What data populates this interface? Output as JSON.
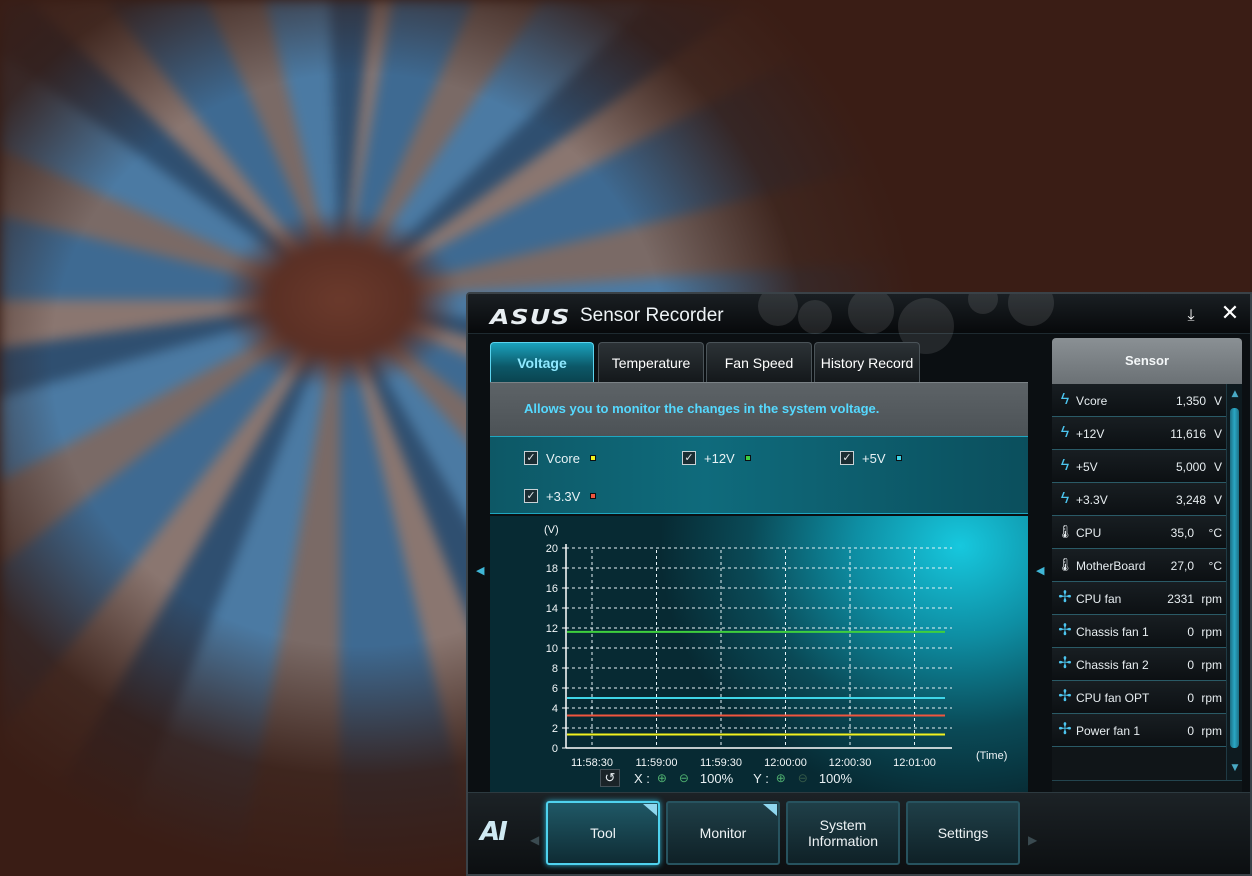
{
  "window": {
    "logo": "ASUS",
    "title": "Sensor Recorder",
    "minimize_glyph": "⤓",
    "close_glyph": "✕"
  },
  "tabs": [
    {
      "label": "Voltage",
      "active": true
    },
    {
      "label": "Temperature",
      "active": false
    },
    {
      "label": "Fan Speed",
      "active": false
    },
    {
      "label": "History Record",
      "active": false
    }
  ],
  "description": "Allows you to monitor the changes in the system voltage.",
  "legend": [
    {
      "label": "Vcore",
      "checked": true,
      "color": "#f2f21e"
    },
    {
      "label": "+12V",
      "checked": true,
      "color": "#3ecf3e"
    },
    {
      "label": "+5V",
      "checked": true,
      "color": "#3fd6e8"
    },
    {
      "label": "+3.3V",
      "checked": true,
      "color": "#f0553e"
    }
  ],
  "chart_data": {
    "type": "line",
    "ylabel": "(V)",
    "xlabel": "(Time)",
    "ylim": [
      0,
      20
    ],
    "yticks": [
      0,
      2,
      4,
      6,
      8,
      10,
      12,
      14,
      16,
      18,
      20
    ],
    "xticks": [
      "11:58:30",
      "11:59:00",
      "11:59:30",
      "12:00:00",
      "12:00:30",
      "12:01:00"
    ],
    "grid": true,
    "series": [
      {
        "name": "Vcore",
        "color": "#f2f21e",
        "value": 1.35
      },
      {
        "name": "+12V",
        "color": "#3ecf3e",
        "value": 11.616
      },
      {
        "name": "+5V",
        "color": "#3fd6e8",
        "value": 5.0
      },
      {
        "name": "+3.3V",
        "color": "#f0553e",
        "value": 3.248
      }
    ]
  },
  "zoom": {
    "x_label": "X :",
    "x_value": "100%",
    "y_label": "Y :",
    "y_value": "100%",
    "reset_glyph": "↺"
  },
  "sensor": {
    "header": "Sensor",
    "rows": [
      {
        "icon": "voltage-icon",
        "name": "Vcore",
        "value": "1,350",
        "unit": "V"
      },
      {
        "icon": "voltage-icon",
        "name": "+12V",
        "value": "11,616",
        "unit": "V"
      },
      {
        "icon": "voltage-icon",
        "name": "+5V",
        "value": "5,000",
        "unit": "V"
      },
      {
        "icon": "voltage-icon",
        "name": "+3.3V",
        "value": "3,248",
        "unit": "V"
      },
      {
        "icon": "thermometer-icon",
        "name": "CPU",
        "value": "35,0",
        "unit": "°C"
      },
      {
        "icon": "thermometer-icon",
        "name": "MotherBoard",
        "value": "27,0",
        "unit": "°C"
      },
      {
        "icon": "fan-icon",
        "name": "CPU fan",
        "value": "2331",
        "unit": "rpm"
      },
      {
        "icon": "fan-icon",
        "name": "Chassis fan 1",
        "value": "0",
        "unit": "rpm"
      },
      {
        "icon": "fan-icon",
        "name": "Chassis fan 2",
        "value": "0",
        "unit": "rpm"
      },
      {
        "icon": "fan-icon",
        "name": "CPU fan OPT",
        "value": "0",
        "unit": "rpm"
      },
      {
        "icon": "fan-icon",
        "name": "Power fan 1",
        "value": "0",
        "unit": "rpm"
      }
    ]
  },
  "bottom_nav": {
    "logo": "AI",
    "buttons": [
      {
        "label": "Tool",
        "active": true
      },
      {
        "label": "Monitor",
        "active": false
      },
      {
        "label": "System\nInformation",
        "active": false
      },
      {
        "label": "Settings",
        "active": false
      }
    ]
  }
}
